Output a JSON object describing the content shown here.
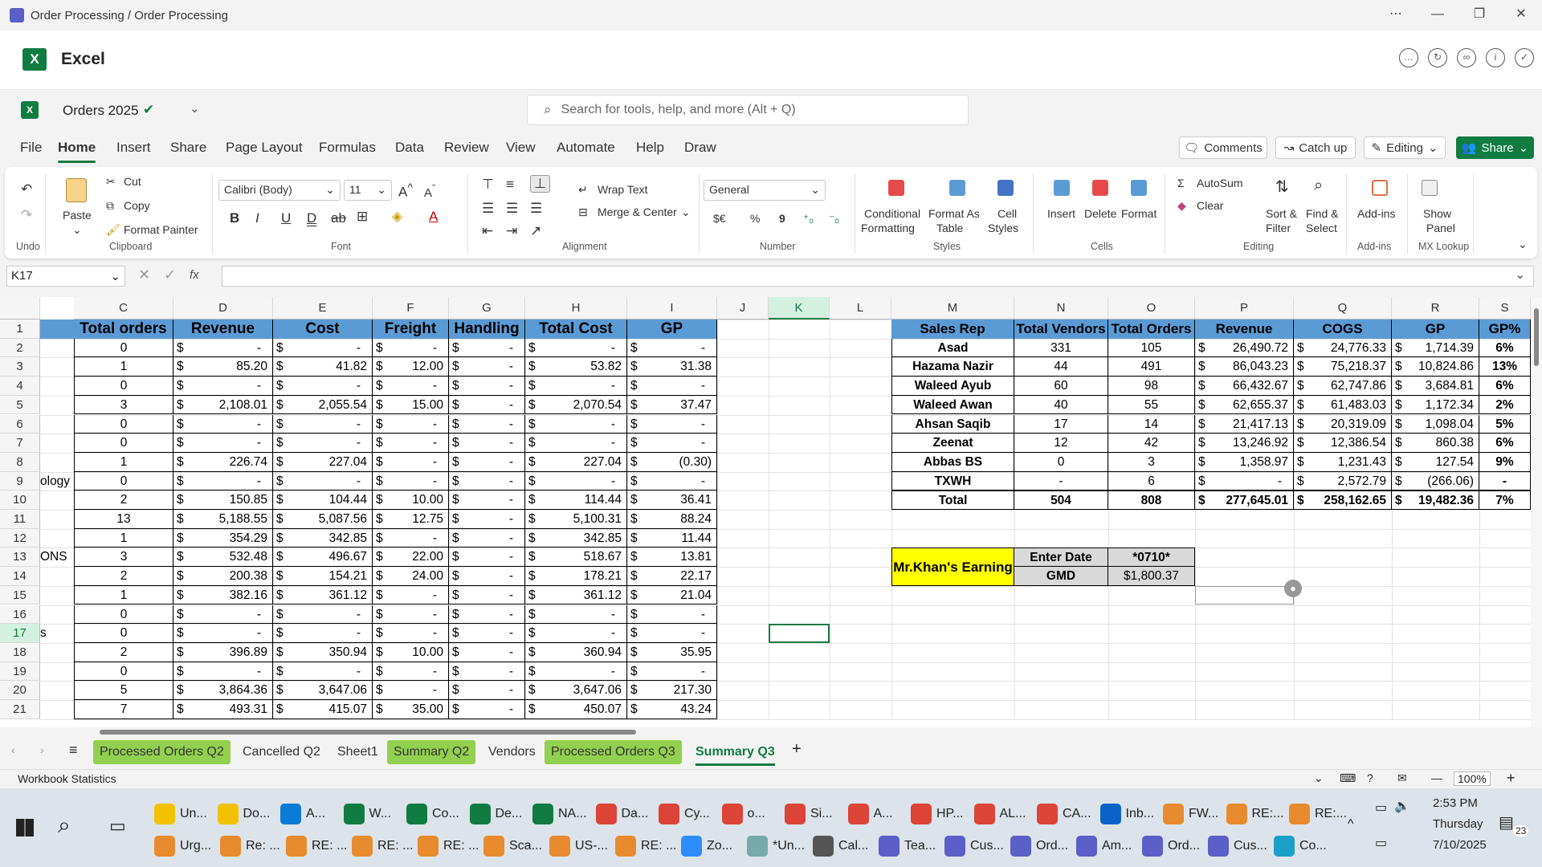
{
  "window": {
    "title": "Order Processing / Order Processing",
    "controls": [
      "⋯",
      "—",
      "❐",
      "✕"
    ]
  },
  "app": {
    "name": "Excel",
    "doc_title": "Orders 2025"
  },
  "search": {
    "placeholder": "Search for tools, help, and more (Alt + Q)"
  },
  "menu": [
    "File",
    "Home",
    "Insert",
    "Share",
    "Page Layout",
    "Formulas",
    "Data",
    "Review",
    "View",
    "Automate",
    "Help",
    "Draw"
  ],
  "menu_active": "Home",
  "top_buttons": {
    "comments": "Comments",
    "catchup": "Catch up",
    "editing": "Editing",
    "share": "Share"
  },
  "ribbon": {
    "undo_group": "Undo",
    "clipboard": {
      "paste": "Paste",
      "cut": "Cut",
      "copy": "Copy",
      "format_painter": "Format Painter",
      "group": "Clipboard"
    },
    "font": {
      "name": "Calibri (Body)",
      "size": "11",
      "group": "Font"
    },
    "alignment": {
      "wrap": "Wrap Text",
      "merge": "Merge & Center",
      "group": "Alignment"
    },
    "number": {
      "format": "General",
      "currency": "$€",
      "percent": "%",
      "comma": "9",
      "group": "Number"
    },
    "styles": {
      "cond1": "Conditional",
      "cond2": "Formatting",
      "fmt1": "Format As",
      "fmt2": "Table",
      "cell1": "Cell",
      "cell2": "Styles",
      "group": "Styles"
    },
    "cells": {
      "insert": "Insert",
      "delete": "Delete",
      "format": "Format",
      "group": "Cells"
    },
    "editing": {
      "autosum": "AutoSum",
      "clear": "Clear",
      "sort1": "Sort &",
      "sort2": "Filter",
      "find1": "Find &",
      "find2": "Select",
      "group": "Editing"
    },
    "addins": {
      "label": "Add-ins",
      "group": "Add-ins"
    },
    "mx": {
      "show": "Show",
      "panel": "Panel",
      "group": "MX Lookup"
    }
  },
  "formula": {
    "namebox": "K17",
    "fx": "fx",
    "value": ""
  },
  "columns": [
    "C",
    "D",
    "E",
    "F",
    "G",
    "H",
    "I",
    "J",
    "K",
    "L",
    "M",
    "N",
    "O",
    "P",
    "Q",
    "R",
    "S"
  ],
  "selected_col": "K",
  "rows": [
    "1",
    "2",
    "3",
    "4",
    "5",
    "6",
    "7",
    "8",
    "9",
    "10",
    "11",
    "12",
    "13",
    "14",
    "15",
    "16",
    "17",
    "18",
    "19",
    "20",
    "21"
  ],
  "selected_row": "17",
  "left_headers": [
    "Total orders",
    "Revenue",
    "Cost",
    "Freight",
    "Handling",
    "Total Cost",
    "GP"
  ],
  "left_rows": [
    [
      "",
      "0",
      "-",
      "-",
      "-",
      "-",
      "-",
      "-"
    ],
    [
      "",
      "1",
      "85.20",
      "41.82",
      "12.00",
      "-",
      "53.82",
      "31.38"
    ],
    [
      "",
      "0",
      "-",
      "-",
      "-",
      "-",
      "-",
      "-"
    ],
    [
      "",
      "3",
      "2,108.01",
      "2,055.54",
      "15.00",
      "-",
      "2,070.54",
      "37.47"
    ],
    [
      "",
      "0",
      "-",
      "-",
      "-",
      "-",
      "-",
      "-"
    ],
    [
      "",
      "0",
      "-",
      "-",
      "-",
      "-",
      "-",
      "-"
    ],
    [
      "",
      "1",
      "226.74",
      "227.04",
      "-",
      "-",
      "227.04",
      "(0.30)"
    ],
    [
      "ology",
      "0",
      "-",
      "-",
      "-",
      "-",
      "-",
      "-"
    ],
    [
      "",
      "2",
      "150.85",
      "104.44",
      "10.00",
      "-",
      "114.44",
      "36.41"
    ],
    [
      "",
      "13",
      "5,188.55",
      "5,087.56",
      "12.75",
      "-",
      "5,100.31",
      "88.24"
    ],
    [
      "",
      "1",
      "354.29",
      "342.85",
      "-",
      "-",
      "342.85",
      "11.44"
    ],
    [
      "ONS",
      "3",
      "532.48",
      "496.67",
      "22.00",
      "-",
      "518.67",
      "13.81"
    ],
    [
      "",
      "2",
      "200.38",
      "154.21",
      "24.00",
      "-",
      "178.21",
      "22.17"
    ],
    [
      "",
      "1",
      "382.16",
      "361.12",
      "-",
      "-",
      "361.12",
      "21.04"
    ],
    [
      "",
      "0",
      "-",
      "-",
      "-",
      "-",
      "-",
      "-"
    ],
    [
      "s",
      "0",
      "-",
      "-",
      "-",
      "-",
      "-",
      "-"
    ],
    [
      "",
      "2",
      "396.89",
      "350.94",
      "10.00",
      "-",
      "360.94",
      "35.95"
    ],
    [
      "",
      "0",
      "-",
      "-",
      "-",
      "-",
      "-",
      "-"
    ],
    [
      "",
      "5",
      "3,864.36",
      "3,647.06",
      "-",
      "-",
      "3,647.06",
      "217.30"
    ],
    [
      "",
      "7",
      "493.31",
      "415.07",
      "35.00",
      "-",
      "450.07",
      "43.24"
    ]
  ],
  "currency_symbol": "$",
  "right_headers": [
    "Sales Rep",
    "Total Vendors",
    "Total Orders",
    "Revenue",
    "COGS",
    "GP",
    "GP%"
  ],
  "right_rows": [
    [
      "Asad",
      "331",
      "105",
      "26,490.72",
      "24,776.33",
      "1,714.39",
      "6%"
    ],
    [
      "Hazama Nazir",
      "44",
      "491",
      "86,043.23",
      "75,218.37",
      "10,824.86",
      "13%"
    ],
    [
      "Waleed Ayub",
      "60",
      "98",
      "66,432.67",
      "62,747.86",
      "3,684.81",
      "6%"
    ],
    [
      "Waleed Awan",
      "40",
      "55",
      "62,655.37",
      "61,483.03",
      "1,172.34",
      "2%"
    ],
    [
      "Ahsan Saqib",
      "17",
      "14",
      "21,417.13",
      "20,319.09",
      "1,098.04",
      "5%"
    ],
    [
      "Zeenat",
      "12",
      "42",
      "13,246.92",
      "12,386.54",
      "860.38",
      "6%"
    ],
    [
      "Abbas BS",
      "0",
      "3",
      "1,358.97",
      "1,231.43",
      "127.54",
      "9%"
    ],
    [
      "TXWH",
      "-",
      "6",
      "-",
      "2,572.79",
      "(266.06)",
      "-"
    ]
  ],
  "right_total": [
    "Total",
    "504",
    "808",
    "277,645.01",
    "258,162.65",
    "19,482.36",
    "7%"
  ],
  "khan": {
    "label": "Mr.Khan's Earning",
    "enter_date": "Enter Date",
    "date_val": "*0710*",
    "gmd": "GMD",
    "gmd_val": "$1,800.37"
  },
  "sheets": [
    {
      "name": "Processed Orders Q2",
      "green": true
    },
    {
      "name": "Cancelled Q2",
      "green": false
    },
    {
      "name": "Sheet1",
      "green": false
    },
    {
      "name": "Summary Q2",
      "green": true
    },
    {
      "name": "Vendors",
      "green": false
    },
    {
      "name": "Processed Orders Q3",
      "green": true
    },
    {
      "name": "Summary Q3",
      "green": false,
      "active": true
    }
  ],
  "status": {
    "left": "Workbook Statistics",
    "zoom": "100%"
  },
  "taskbar": {
    "row1": [
      {
        "t": "Un...",
        "c": "#f2c200"
      },
      {
        "t": "Do...",
        "c": "#f2c200"
      },
      {
        "t": "A...",
        "c": "#0a7bd6"
      },
      {
        "t": "W...",
        "c": "#107c41"
      },
      {
        "t": "Co...",
        "c": "#107c41"
      },
      {
        "t": "De...",
        "c": "#107c41"
      },
      {
        "t": "NA...",
        "c": "#107c41"
      },
      {
        "t": "Da...",
        "c": "#db4437"
      },
      {
        "t": "Cy...",
        "c": "#db4437"
      },
      {
        "t": "o...",
        "c": "#db4437"
      },
      {
        "t": "Si...",
        "c": "#db4437"
      },
      {
        "t": "A...",
        "c": "#db4437"
      },
      {
        "t": "HP...",
        "c": "#db4437"
      },
      {
        "t": "AL...",
        "c": "#db4437"
      },
      {
        "t": "CA...",
        "c": "#db4437"
      },
      {
        "t": "Inb...",
        "c": "#0a64c8"
      },
      {
        "t": "FW...",
        "c": "#e88b2e"
      },
      {
        "t": "RE:...",
        "c": "#e88b2e"
      },
      {
        "t": "RE:...",
        "c": "#e88b2e"
      }
    ],
    "row2": [
      {
        "t": "Urg...",
        "c": "#e88b2e"
      },
      {
        "t": "Re: ...",
        "c": "#e88b2e"
      },
      {
        "t": "RE: ...",
        "c": "#e88b2e"
      },
      {
        "t": "RE: ...",
        "c": "#e88b2e"
      },
      {
        "t": "RE: ...",
        "c": "#e88b2e"
      },
      {
        "t": "Sca...",
        "c": "#e88b2e"
      },
      {
        "t": "US-...",
        "c": "#e88b2e"
      },
      {
        "t": "RE: ...",
        "c": "#e88b2e"
      },
      {
        "t": "Zo...",
        "c": "#2d8cff"
      },
      {
        "t": "*Un...",
        "c": "#7aa"
      },
      {
        "t": "Cal...",
        "c": "#555"
      },
      {
        "t": "Tea...",
        "c": "#5b5fc7"
      },
      {
        "t": "Cus...",
        "c": "#5b5fc7"
      },
      {
        "t": "Ord...",
        "c": "#5b5fc7"
      },
      {
        "t": "Am...",
        "c": "#5b5fc7"
      },
      {
        "t": "Ord...",
        "c": "#5b5fc7"
      },
      {
        "t": "Cus...",
        "c": "#5b5fc7"
      },
      {
        "t": "Co...",
        "c": "#1aa0c8"
      }
    ],
    "time": "2:53 PM",
    "day": "Thursday",
    "date": "7/10/2025",
    "badge": "23"
  },
  "colors": {
    "excel_green": "#107c41",
    "header_blue": "#5b9bd5",
    "yellow": "#ffff00",
    "gray": "#d9d9d9"
  }
}
